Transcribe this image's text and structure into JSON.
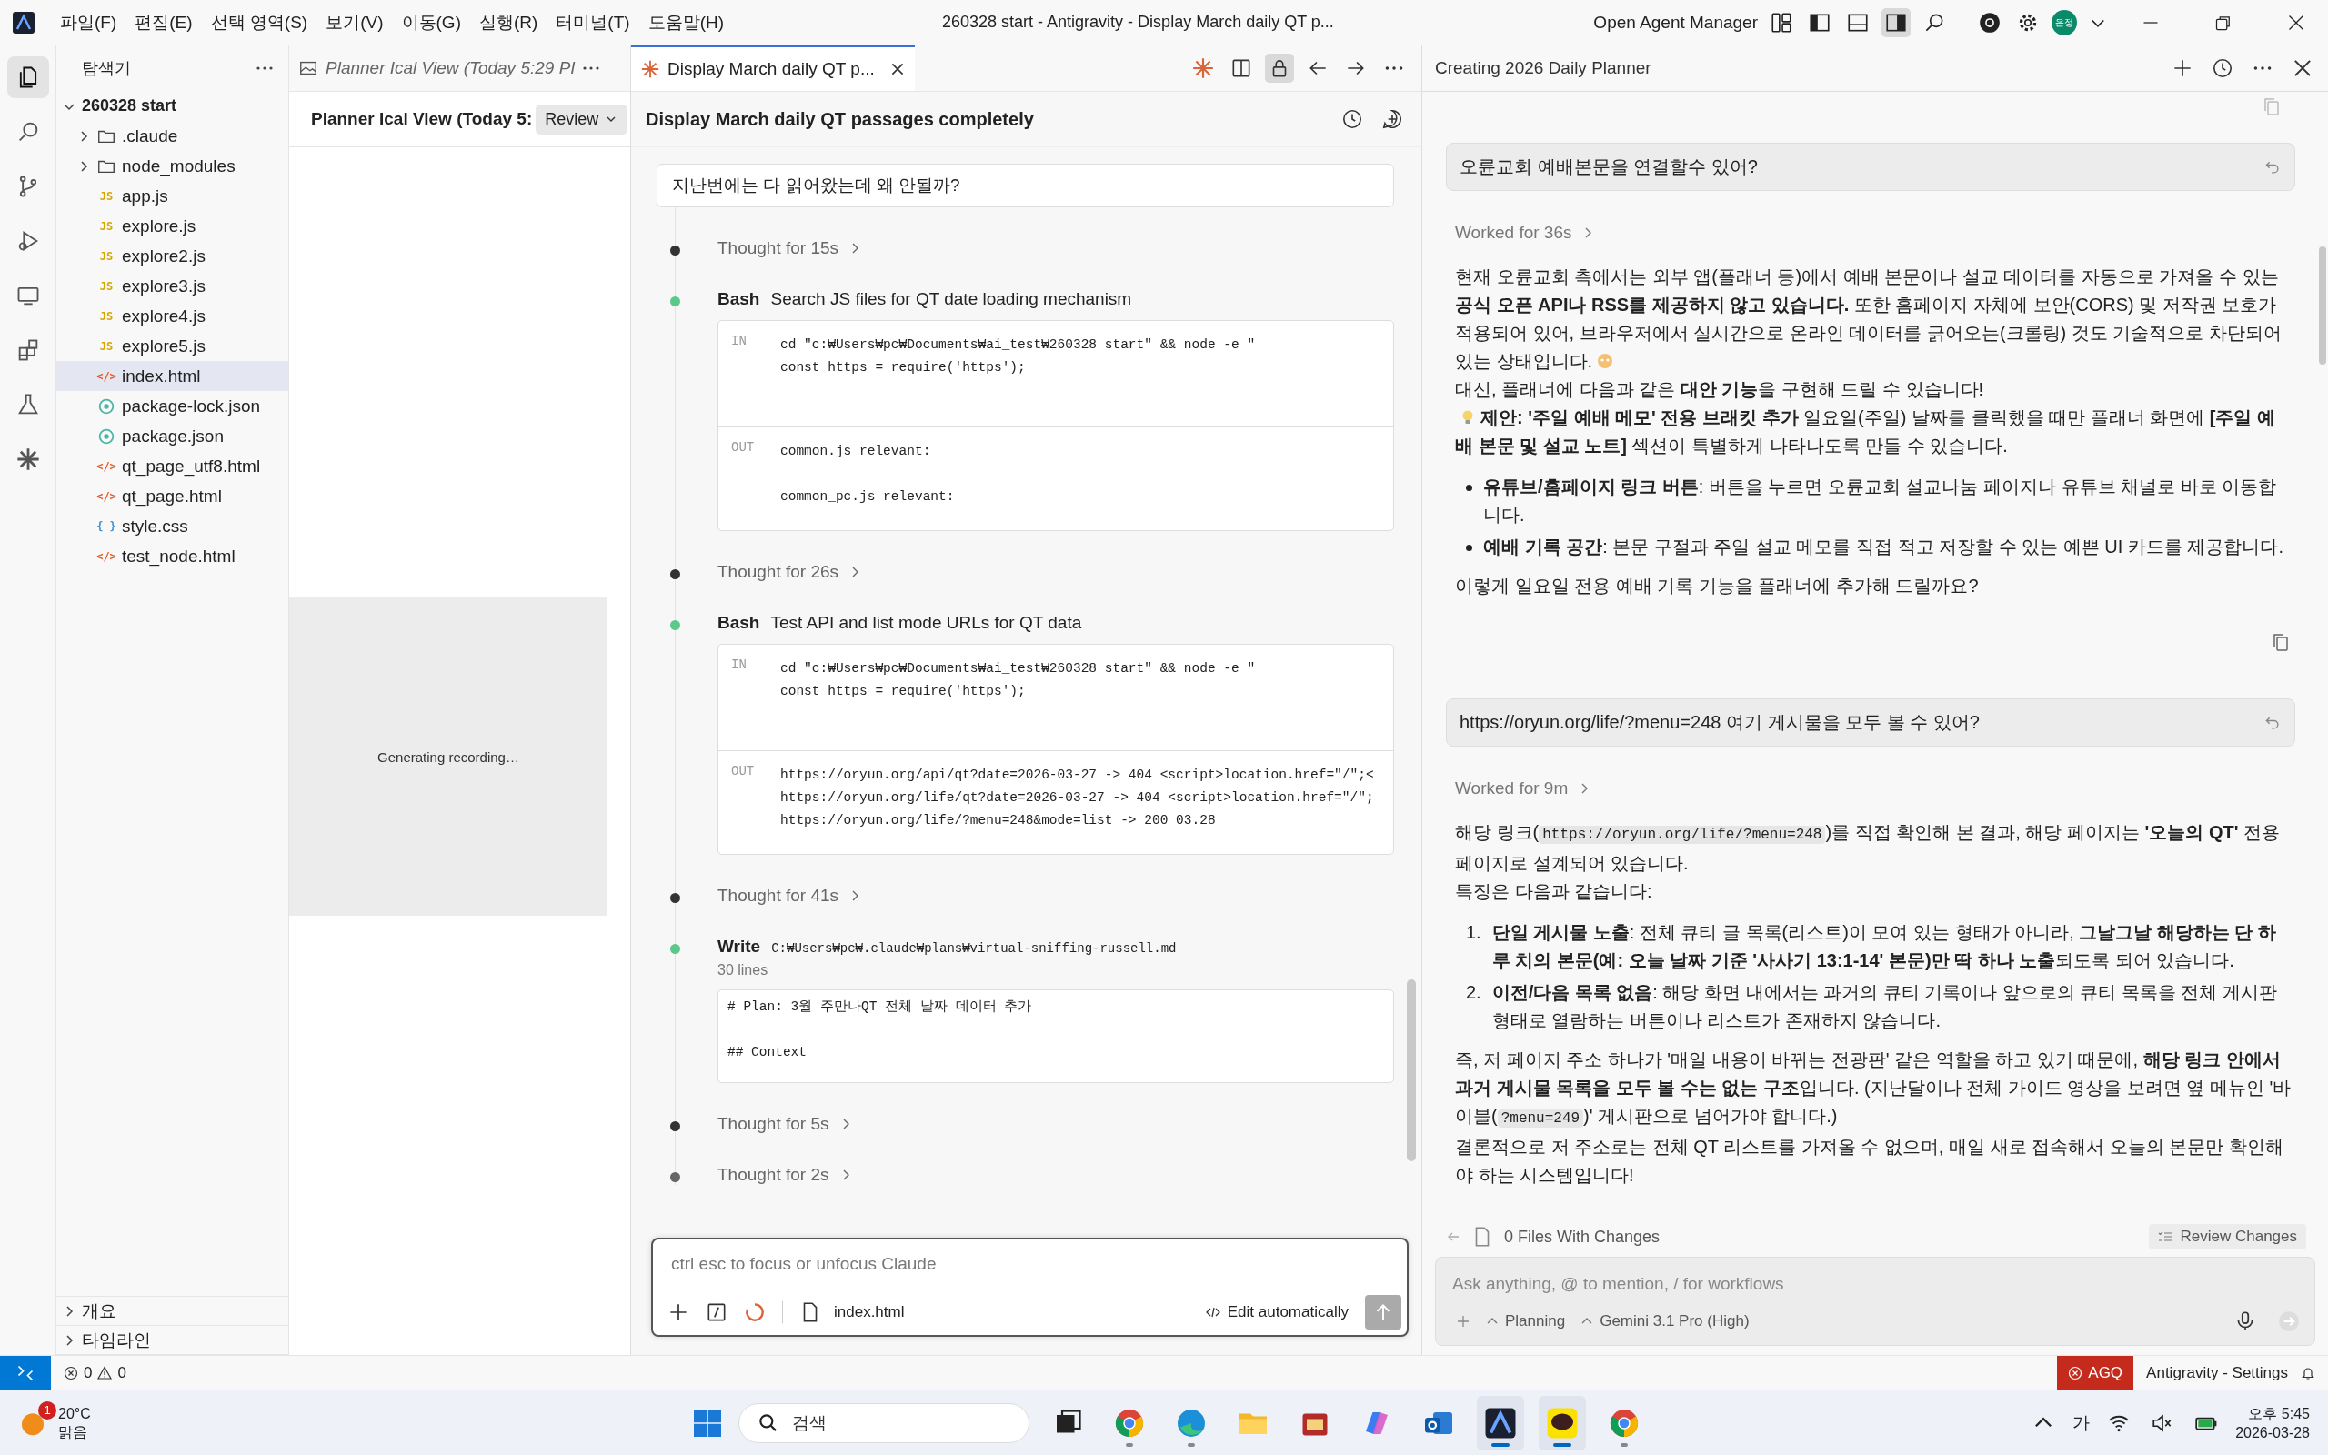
{
  "title_bar": {
    "menus": [
      "파일(F)",
      "편집(E)",
      "선택 영역(S)",
      "보기(V)",
      "이동(G)",
      "실행(R)",
      "터미널(T)",
      "도움말(H)"
    ],
    "title": "260328 start - Antigravity - Display March daily QT p...",
    "agent_manager": "Open Agent Manager",
    "avatar": "은정"
  },
  "activity_bar": [
    {
      "kind": "files",
      "selected": true
    },
    {
      "kind": "search",
      "selected": false
    },
    {
      "kind": "branch",
      "selected": false
    },
    {
      "kind": "debug",
      "selected": false
    },
    {
      "kind": "remote",
      "selected": false
    },
    {
      "kind": "extensions",
      "selected": false
    },
    {
      "kind": "flask",
      "selected": false
    },
    {
      "kind": "sparkle",
      "selected": false
    }
  ],
  "explorer": {
    "title": "탐색기",
    "root": {
      "label": "260328 start",
      "expanded": true,
      "children": [
        {
          "label": ".claude",
          "kind": "folder",
          "expanded": false,
          "selected": false
        },
        {
          "label": "node_modules",
          "kind": "folder",
          "expanded": false,
          "selected": false
        },
        {
          "label": "app.js",
          "kind": "js",
          "icon": "JS",
          "selected": false
        },
        {
          "label": "explore.js",
          "kind": "js",
          "icon": "JS",
          "selected": false
        },
        {
          "label": "explore2.js",
          "kind": "js",
          "icon": "JS",
          "selected": false
        },
        {
          "label": "explore3.js",
          "kind": "js",
          "icon": "JS",
          "selected": false
        },
        {
          "label": "explore4.js",
          "kind": "js",
          "icon": "JS",
          "selected": false
        },
        {
          "label": "explore5.js",
          "kind": "js",
          "icon": "JS",
          "selected": false
        },
        {
          "label": "index.html",
          "kind": "html",
          "icon": "</>",
          "selected": true
        },
        {
          "label": "package-lock.json",
          "kind": "json",
          "selected": false
        },
        {
          "label": "package.json",
          "kind": "json",
          "selected": false
        },
        {
          "label": "qt_page_utf8.html",
          "kind": "html",
          "icon": "</>",
          "selected": false
        },
        {
          "label": "qt_page.html",
          "kind": "html",
          "icon": "</>",
          "selected": false
        },
        {
          "label": "style.css",
          "kind": "css",
          "icon": "{ }",
          "selected": false
        },
        {
          "label": "test_node.html",
          "kind": "html",
          "icon": "</>",
          "selected": false
        }
      ]
    },
    "sections": [
      {
        "label": "개요",
        "expanded": false
      },
      {
        "label": "타임라인",
        "expanded": false
      }
    ]
  },
  "planner": {
    "tab": "Planner Ical View (Today 5:29 PI",
    "title": "Planner Ical View (Today 5:",
    "review_button": "Review",
    "status": "Generating recording…"
  },
  "chat": {
    "tab": "Display March daily QT p...",
    "title": "Display March daily QT passages completely",
    "user_message": "지난번에는 다 읽어왔는데 왜 안될까?",
    "steps": [
      {
        "kind": "thought",
        "label": "Thought for 15s",
        "color": "#333333"
      },
      {
        "kind": "bash",
        "tool": "Bash",
        "description": "Search JS files for QT date loading mechanism",
        "color": "#5cc98a",
        "input_label": "IN",
        "input": "cd \"c:₩Users₩pc₩Documents₩ai_test₩260328 start\" && node -e \"\nconst https = require('https');",
        "output_label": "OUT",
        "output": "common.js relevant:\n\ncommon_pc.js relevant:"
      },
      {
        "kind": "thought",
        "label": "Thought for 26s",
        "color": "#333333"
      },
      {
        "kind": "bash",
        "tool": "Bash",
        "description": "Test API and list mode URLs for QT data",
        "color": "#5cc98a",
        "input_label": "IN",
        "input": "cd \"c:₩Users₩pc₩Documents₩ai_test₩260328 start\" && node -e \"\nconst https = require('https');",
        "output_label": "OUT",
        "output": "https://oryun.org/api/qt?date=2026-03-27 -> 404 <script>location.href=\"/\";<\nhttps://oryun.org/life/qt?date=2026-03-27 -> 404 <script>location.href=\"/\";\nhttps://oryun.org/life/?menu=248&mode=list -> 200 03.28"
      },
      {
        "kind": "thought",
        "label": "Thought for 41s",
        "color": "#333333"
      },
      {
        "kind": "write",
        "tool": "Write",
        "path": "C:₩Users₩pc₩.claude₩plans₩virtual-sniffing-russell.md",
        "meta": "30 lines",
        "color": "#5cc98a",
        "content": "# Plan: 3월 주만나QT 전체 날짜 데이터 추가\n\n## Context"
      },
      {
        "kind": "thought",
        "label": "Thought for 5s",
        "color": "#333333"
      },
      {
        "kind": "thought",
        "label": "Thought for 2s",
        "color": "#666666"
      }
    ],
    "input": {
      "placeholder": "ctrl esc to focus or unfocus Claude",
      "file": "index.html",
      "mode": "Edit automatically"
    }
  },
  "agent_panel": {
    "title": "Creating 2026 Daily Planner",
    "messages": [
      {
        "kind": "user",
        "text": "오륜교회 예배본문을 연결할수 있어?"
      },
      {
        "kind": "assistant",
        "worked": "Worked for 36s",
        "blocks": [
          {
            "kind": "p",
            "lines": [
              [
                {
                  "kind": "text",
                  "text": "현재 오륜교회 측에서는 외부 앱(플래너 등)에서 예배 본문이나 설교 데이터를 자동으로 가져올 수 있는 **공식 오픈 API나 RSS를 제공하지 않고 있습니다.** 또한 홈페이지 자체에 보안(CORS) 및 저작권 보호가 적용되어 있어, 브라우저에서 실시간으로 온라인 데이터를 긁어오는(크롤링) 것도 기술적으로 차단되어 있는 상태입니다."
                },
                {
                  "kind": "emoji"
                }
              ],
              [
                {
                  "kind": "text",
                  "text": "대신, 플래너에 다음과 같은 **대안 기능**을 구현해 드릴 수 있습니다!"
                }
              ],
              [
                {
                  "kind": "bulb"
                },
                {
                  "kind": "text",
                  "text": "**제안: '주일 예배 메모' 전용 브래킷 추가** 일요일(주일) 날짜를 클릭했을 때만 플래너 화면에 **[주일 예배 본문 및 설교 노트]** 섹션이 특별하게 나타나도록 만들 수 있습니다."
                }
              ]
            ]
          },
          {
            "kind": "ul",
            "items": [
              [
                {
                  "kind": "text",
                  "text": "**유튜브/홈페이지 링크 버튼**: 버튼을 누르면 오륜교회 설교나눔 페이지나 유튜브 채널로 바로 이동합니다."
                }
              ],
              [
                {
                  "kind": "text",
                  "text": "**예배 기록 공간**: 본문 구절과 주일 설교 메모를 직접 적고 저장할 수 있는 예쁜 UI 카드를 제공합니다."
                }
              ]
            ]
          },
          {
            "kind": "p",
            "lines": [
              [
                {
                  "kind": "text",
                  "text": "이렇게 일요일 전용 예배 기록 기능을 플래너에 추가해 드릴까요?"
                }
              ]
            ]
          }
        ]
      },
      {
        "kind": "user",
        "text": "https://oryun.org/life/?menu=248 여기 게시물을 모두 볼 수 있어?"
      },
      {
        "kind": "assistant",
        "worked": "Worked for 9m",
        "blocks": [
          {
            "kind": "p",
            "lines": [
              [
                {
                  "kind": "text",
                  "text": "해당 링크("
                },
                {
                  "kind": "code",
                  "text": "https://oryun.org/life/?menu=248"
                },
                {
                  "kind": "text",
                  "text": ")를 직접 확인해 본 결과, 해당 페이지는 **'오늘의 QT'** 전용 페이지로 설계되어 있습니다."
                }
              ],
              [
                {
                  "kind": "text",
                  "text": "특징은 다음과 같습니다:"
                }
              ]
            ]
          },
          {
            "kind": "ol",
            "items": [
              {
                "number": "1.",
                "parts": [
                  {
                    "kind": "text",
                    "text": "**단일 게시물 노출**: 전체 큐티 글 목록(리스트)이 모여 있는 형태가 아니라, **그날그날 해당하는 단 하루 치의 본문(예: 오늘 날짜 기준 '사사기 13:1-14' 본문)만 딱 하나 노출**되도록 되어 있습니다."
                  }
                ]
              },
              {
                "number": "2.",
                "parts": [
                  {
                    "kind": "text",
                    "text": "**이전/다음 목록 없음**: 해당 화면 내에서는 과거의 큐티 기록이나 앞으로의 큐티 목록을 전체 게시판 형태로 열람하는 버튼이나 리스트가 존재하지 않습니다."
                  }
                ]
              }
            ]
          },
          {
            "kind": "p",
            "lines": [
              [
                {
                  "kind": "text",
                  "text": "즉, 저 페이지 주소 하나가 '매일 내용이 바뀌는 전광판' 같은 역할을 하고 있기 때문에, **해당 링크 안에서 과거 게시물 목록을 모두 볼 수는 없는 구조**입니다. (지난달이나 전체 가이드 영상을 보려면 옆 메뉴인 '바이블("
                },
                {
                  "kind": "code",
                  "text": "?menu=249"
                },
                {
                  "kind": "text",
                  "text": ")' 게시판으로 넘어가야 합니다.)"
                }
              ],
              [
                {
                  "kind": "text",
                  "text": "결론적으로 저 주소로는 전체 QT 리스트를 가져올 수 없으며, 매일 새로 접속해서 오늘의 본문만 확인해야 하는 시스템입니다!"
                }
              ]
            ]
          }
        ]
      }
    ],
    "changes": "0 Files With Changes",
    "review_button": "Review Changes",
    "input": {
      "placeholder": "Ask anything, @ to mention, / for workflows",
      "mode": "Planning",
      "model": "Gemini 3.1 Pro (High)"
    }
  },
  "status_bar": {
    "errors": "0",
    "warnings": "0",
    "badge": "AGQ",
    "settings": "Antigravity - Settings"
  },
  "taskbar": {
    "weather": {
      "temperature": "20°C",
      "condition": "맑음",
      "alerts": "1"
    },
    "search": "검색",
    "apps": [
      {
        "kind": "taskview",
        "running": false,
        "selected": false
      },
      {
        "kind": "chrome",
        "running": true,
        "selected": false
      },
      {
        "kind": "edge",
        "running": true,
        "selected": false
      },
      {
        "kind": "folder",
        "running": false,
        "selected": false
      },
      {
        "kind": "game",
        "running": false,
        "selected": false
      },
      {
        "kind": "copilot",
        "running": false,
        "selected": false
      },
      {
        "kind": "mail",
        "running": false,
        "selected": false
      },
      {
        "kind": "antigravity",
        "running": true,
        "selected": true
      },
      {
        "kind": "talk",
        "running": true,
        "selected": true
      },
      {
        "kind": "chrome",
        "running": true,
        "selected": false
      }
    ],
    "ime": "가",
    "time": "오후 5:45",
    "date": "2026-03-28"
  }
}
